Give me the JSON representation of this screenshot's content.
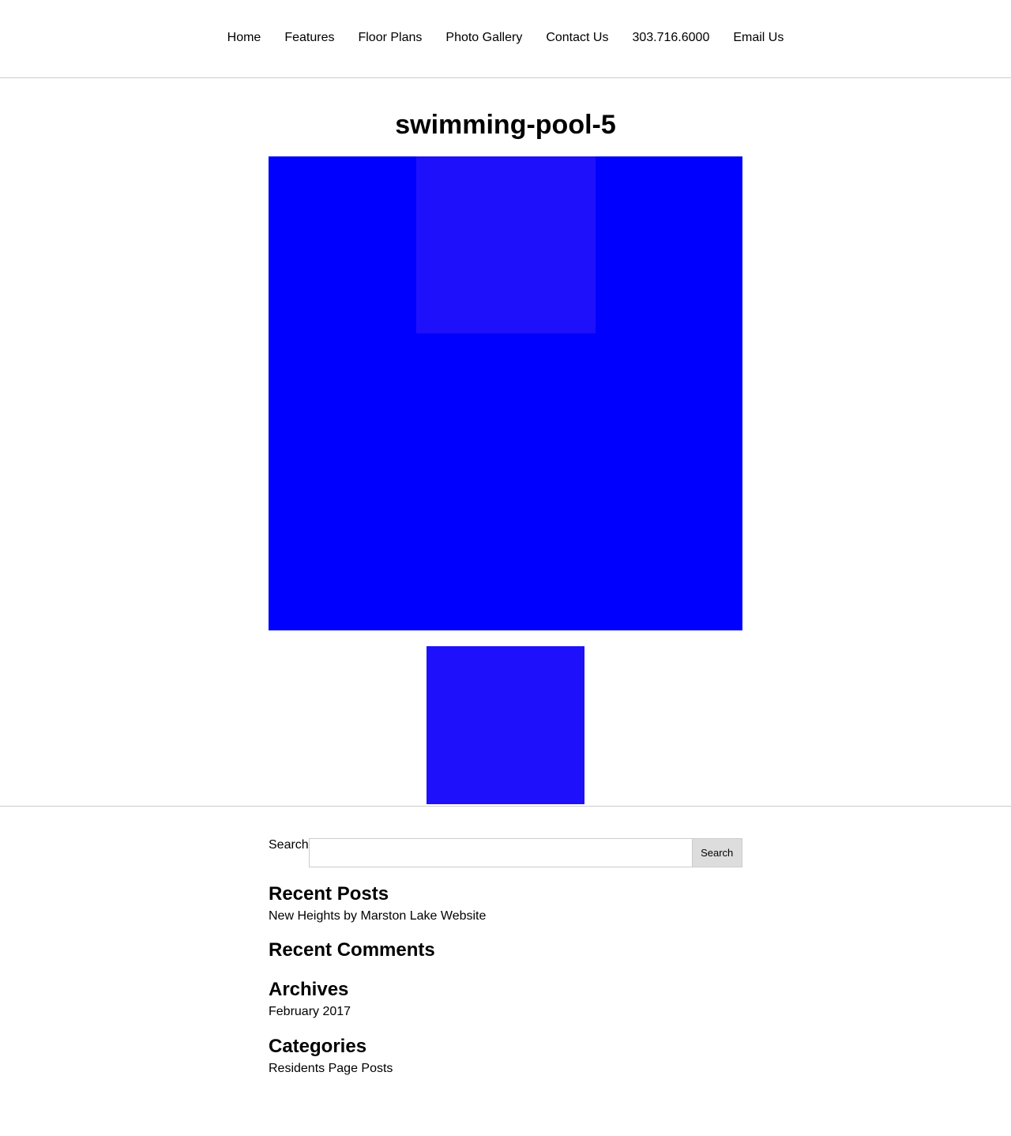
{
  "nav": {
    "items": [
      {
        "label": "Home"
      },
      {
        "label": "Features"
      },
      {
        "label": "Floor Plans"
      },
      {
        "label": "Photo Gallery"
      },
      {
        "label": "Contact Us"
      },
      {
        "label": "303.716.6000"
      },
      {
        "label": "Email Us"
      }
    ]
  },
  "page": {
    "title": "swimming-pool-5"
  },
  "colors": {
    "hero": "#0000ff",
    "hero_inner": "#1e10fa",
    "thumb": "#1e10fa",
    "search_button_bg": "#dddddd",
    "divider": "#cccccc"
  },
  "search": {
    "label": "Search",
    "value": "",
    "placeholder": "",
    "button_label": "Search"
  },
  "widgets": {
    "recent_posts": {
      "title": "Recent Posts",
      "items": [
        "New Heights by Marston Lake Website"
      ]
    },
    "recent_comments": {
      "title": "Recent Comments"
    },
    "archives": {
      "title": "Archives",
      "items": [
        "February 2017"
      ]
    },
    "categories": {
      "title": "Categories",
      "items": [
        "Residents Page Posts"
      ]
    }
  }
}
